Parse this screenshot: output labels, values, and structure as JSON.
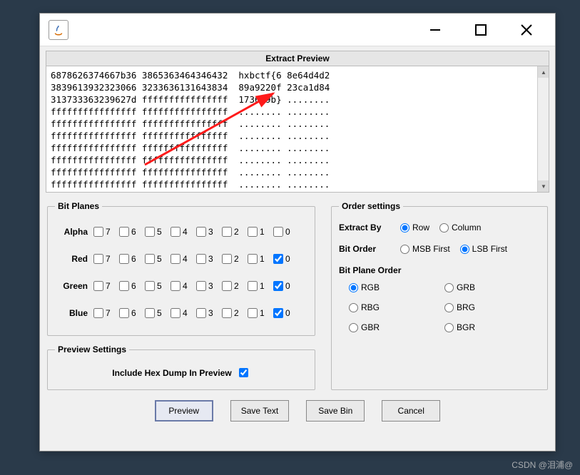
{
  "preview_title": "Extract Preview",
  "hex_lines": [
    "6878626374667b36 3865363464346432  hxbctf{6 8e64d4d2",
    "3839613932323066 3233636131643834  89a9220f 23ca1d84",
    "313733363239627d ffffffffffffffff  173629b} ........",
    "ffffffffffffffff ffffffffffffffff  ........ ........",
    "ffffffffffffffff ffffffffffffffff  ........ ........",
    "ffffffffffffffff ffffffffffffffff  ........ ........",
    "ffffffffffffffff ffffffffffffffff  ........ ........",
    "ffffffffffffffff ffffffffffffffff  ........ ........",
    "ffffffffffffffff ffffffffffffffff  ........ ........",
    "ffffffffffffffff ffffffffffffffff  ........ ........"
  ],
  "groups": {
    "bit_planes": "Bit Planes",
    "preview_settings": "Preview Settings",
    "order_settings": "Order settings",
    "bit_plane_order": "Bit Plane Order"
  },
  "channels": [
    {
      "name": "Alpha",
      "checked": []
    },
    {
      "name": "Red",
      "checked": [
        0
      ]
    },
    {
      "name": "Green",
      "checked": [
        0
      ]
    },
    {
      "name": "Blue",
      "checked": [
        0
      ]
    }
  ],
  "bit_labels": [
    "7",
    "6",
    "5",
    "4",
    "3",
    "2",
    "1",
    "0"
  ],
  "preview_settings_label": "Include Hex Dump In Preview",
  "preview_hex_checked": true,
  "order": {
    "extract_by": {
      "label": "Extract By",
      "options": [
        "Row",
        "Column"
      ],
      "selected": "Row"
    },
    "bit_order": {
      "label": "Bit Order",
      "options": [
        "MSB First",
        "LSB First"
      ],
      "selected": "LSB First"
    },
    "plane_order": {
      "options": [
        "RGB",
        "GRB",
        "RBG",
        "BRG",
        "GBR",
        "BGR"
      ],
      "selected": "RGB"
    }
  },
  "buttons": {
    "preview": "Preview",
    "save_text": "Save Text",
    "save_bin": "Save Bin",
    "cancel": "Cancel"
  },
  "watermark": "CSDN @泪浦@"
}
